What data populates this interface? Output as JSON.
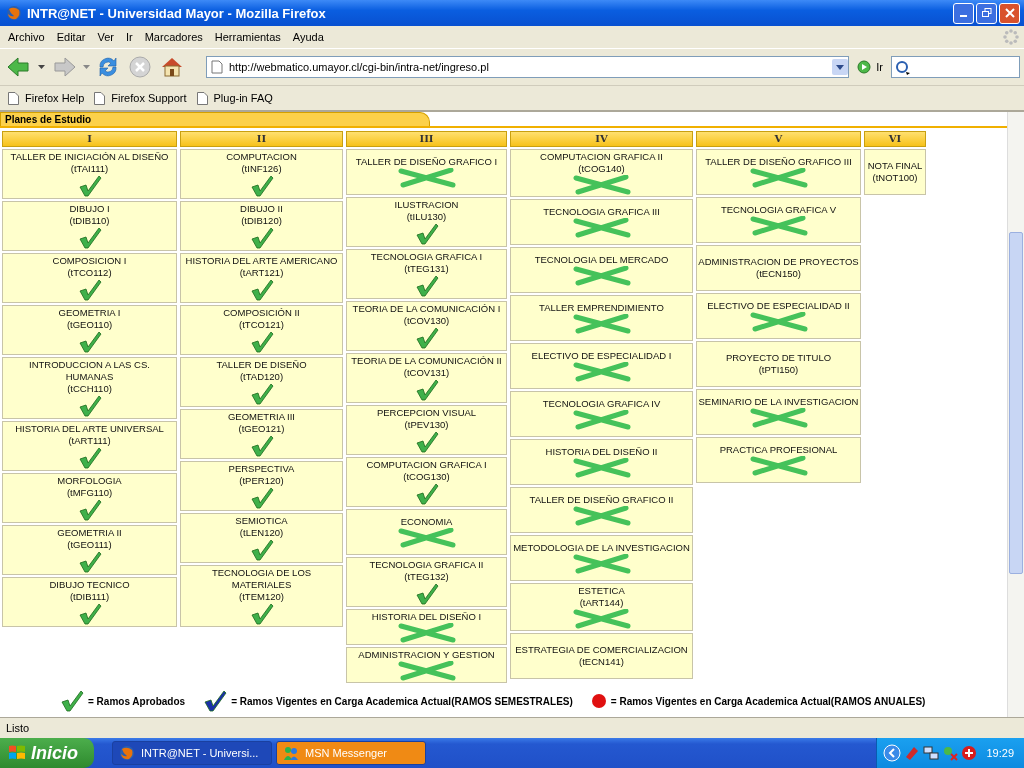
{
  "window": {
    "title": "INTR@NET - Universidad Mayor - Mozilla Firefox"
  },
  "menu": [
    "Archivo",
    "Editar",
    "Ver",
    "Ir",
    "Marcadores",
    "Herramientas",
    "Ayuda"
  ],
  "address_bar": {
    "url": "http://webmatico.umayor.cl/cgi-bin/intra-net/ingreso.pl",
    "go_label": "Ir"
  },
  "bookmarks": [
    "Firefox Help",
    "Firefox Support",
    "Plug-in FAQ"
  ],
  "page": {
    "tab": "Planes de Estudio",
    "columns": [
      {
        "heading": "I",
        "courses": [
          {
            "name": "TALLER DE INICIACIÓN AL DISEÑO",
            "code": "(tTAI111)",
            "kind": "check"
          },
          {
            "name": "DIBUJO I",
            "code": "(tDIB110)",
            "kind": "check"
          },
          {
            "name": "COMPOSICION I",
            "code": "(tTCO112)",
            "kind": "check"
          },
          {
            "name": "GEOMETRIA I",
            "code": "(tGEO110)",
            "kind": "check"
          },
          {
            "name": "INTRODUCCION A LAS CS. HUMANAS",
            "code": "(tCCH110)",
            "kind": "check"
          },
          {
            "name": "HISTORIA DEL ARTE UNIVERSAL",
            "code": "(tART111)",
            "kind": "check"
          },
          {
            "name": "MORFOLOGIA",
            "code": "(tMFG110)",
            "kind": "check"
          },
          {
            "name": "GEOMETRIA II",
            "code": "(tGEO111)",
            "kind": "check"
          },
          {
            "name": "DIBUJO TECNICO",
            "code": "(tDIB111)",
            "kind": "check"
          }
        ]
      },
      {
        "heading": "II",
        "courses": [
          {
            "name": "COMPUTACION",
            "code": "(tINF126)",
            "kind": "check"
          },
          {
            "name": "DIBUJO II",
            "code": "(tDIB120)",
            "kind": "check"
          },
          {
            "name": "HISTORIA DEL ARTE AMERICANO",
            "code": "(tART121)",
            "kind": "check"
          },
          {
            "name": "COMPOSICIÓN II",
            "code": "(tTCO121)",
            "kind": "check"
          },
          {
            "name": "TALLER DE DISEÑO",
            "code": "(tTAD120)",
            "kind": "check"
          },
          {
            "name": "GEOMETRIA III",
            "code": "(tGEO121)",
            "kind": "check"
          },
          {
            "name": "PERSPECTIVA",
            "code": "(tPER120)",
            "kind": "check"
          },
          {
            "name": "SEMIOTICA",
            "code": "(tLEN120)",
            "kind": "check"
          },
          {
            "name": "TECNOLOGIA DE LOS MATERIALES",
            "code": "(tTEM120)",
            "kind": "check"
          }
        ]
      },
      {
        "heading": "III",
        "courses": [
          {
            "name": "TALLER DE DISEÑO GRAFICO I",
            "kind": "cross"
          },
          {
            "name": "ILUSTRACION",
            "code": "(tILU130)",
            "kind": "check"
          },
          {
            "name": "TECNOLOGIA GRAFICA I",
            "code": "(tTEG131)",
            "kind": "check"
          },
          {
            "name": "TEORIA DE LA COMUNICACIÓN I",
            "code": "(tCOV130)",
            "kind": "check"
          },
          {
            "name": "TEORIA DE LA COMUNICACIÓN II",
            "code": "(tCOV131)",
            "kind": "check"
          },
          {
            "name": "PERCEPCION VISUAL",
            "code": "(tPEV130)",
            "kind": "check"
          },
          {
            "name": "COMPUTACION GRAFICA I",
            "code": "(tCOG130)",
            "kind": "check"
          },
          {
            "name": "ECONOMIA",
            "kind": "cross"
          },
          {
            "name": "TECNOLOGIA GRAFICA II",
            "code": "(tTEG132)",
            "kind": "check"
          },
          {
            "name": "HISTORIA DEL DISEÑO I",
            "kind": "cross"
          },
          {
            "name": "ADMINISTRACION Y GESTION",
            "kind": "cross"
          }
        ]
      },
      {
        "heading": "IV",
        "courses": [
          {
            "name": "COMPUTACION GRAFICA II",
            "code": "(tCOG140)",
            "kind": "cross"
          },
          {
            "name": "TECNOLOGIA GRAFICA III",
            "kind": "cross"
          },
          {
            "name": "TECNOLOGIA DEL MERCADO",
            "kind": "cross"
          },
          {
            "name": "TALLER EMPRENDIMIENTO",
            "kind": "cross"
          },
          {
            "name": "ELECTIVO DE ESPECIALIDAD I",
            "kind": "cross"
          },
          {
            "name": "TECNOLOGIA GRAFICA IV",
            "kind": "cross"
          },
          {
            "name": "HISTORIA DEL DISEÑO II",
            "kind": "cross"
          },
          {
            "name": "TALLER DE DISEÑO GRAFICO II",
            "kind": "cross"
          },
          {
            "name": "METODOLOGIA DE LA INVESTIGACION",
            "kind": "cross"
          },
          {
            "name": "ESTETICA",
            "code": "(tART144)",
            "kind": "cross"
          },
          {
            "name": "ESTRATEGIA DE COMERCIALIZACION",
            "code": "(tECN141)",
            "kind": "plain"
          }
        ]
      },
      {
        "heading": "V",
        "courses": [
          {
            "name": "TALLER DE DISEÑO GRAFICO III",
            "kind": "cross"
          },
          {
            "name": "TECNOLOGIA GRAFICA V",
            "kind": "cross"
          },
          {
            "name": "ADMINISTRACION DE PROYECTOS",
            "code": "(tECN150)",
            "kind": "plain"
          },
          {
            "name": "ELECTIVO DE ESPECIALIDAD II",
            "kind": "cross"
          },
          {
            "name": "PROYECTO DE TITULO",
            "code": "(tPTI150)",
            "kind": "plain"
          },
          {
            "name": "SEMINARIO DE LA INVESTIGACION",
            "kind": "cross"
          },
          {
            "name": "PRACTICA PROFESIONAL",
            "kind": "cross"
          }
        ]
      },
      {
        "heading": "VI",
        "courses": [
          {
            "name": "NOTA FINAL",
            "code": "(tNOT100)",
            "kind": "plain"
          }
        ]
      }
    ],
    "legend": [
      {
        "kind": "check",
        "text": "= Ramos Aprobados"
      },
      {
        "kind": "blue-check",
        "text": "= Ramos Vigentes en Carga Academica Actual(RAMOS SEMESTRALES)"
      },
      {
        "kind": "red-dot",
        "text": "= Ramos Vigentes en Carga Academica Actual(RAMOS ANUALES)"
      }
    ]
  },
  "status_bar": "Listo",
  "taskbar": {
    "start": "Inicio",
    "tasks": [
      {
        "label": "INTR@NET - Universi...",
        "selected": true,
        "flashing": false
      },
      {
        "label": "MSN Messenger",
        "selected": false,
        "flashing": true
      }
    ],
    "clock": "19:29"
  }
}
